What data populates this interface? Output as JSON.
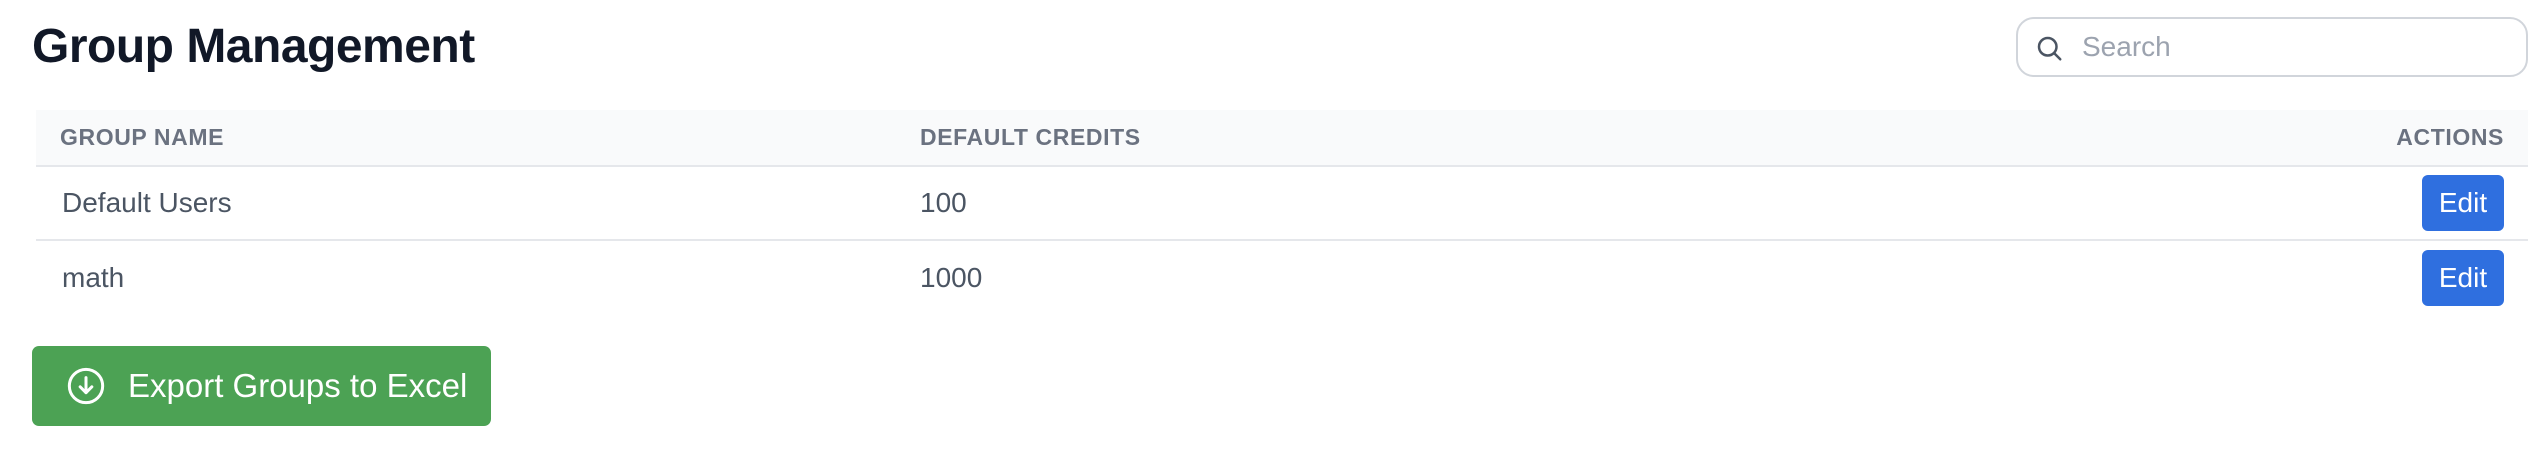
{
  "header": {
    "title": "Group Management"
  },
  "search": {
    "placeholder": "Search",
    "value": ""
  },
  "table": {
    "columns": [
      "GROUP NAME",
      "DEFAULT CREDITS",
      "ACTIONS"
    ],
    "rows": [
      {
        "name": "Default Users",
        "credits": "100",
        "action": "Edit"
      },
      {
        "name": "math",
        "credits": "1000",
        "action": "Edit"
      }
    ]
  },
  "export": {
    "label": "Export Groups to Excel",
    "icon": "download-circle-icon"
  },
  "colors": {
    "edit_button": "#2f6fdf",
    "export_button": "#4ca254",
    "title": "#111827"
  }
}
